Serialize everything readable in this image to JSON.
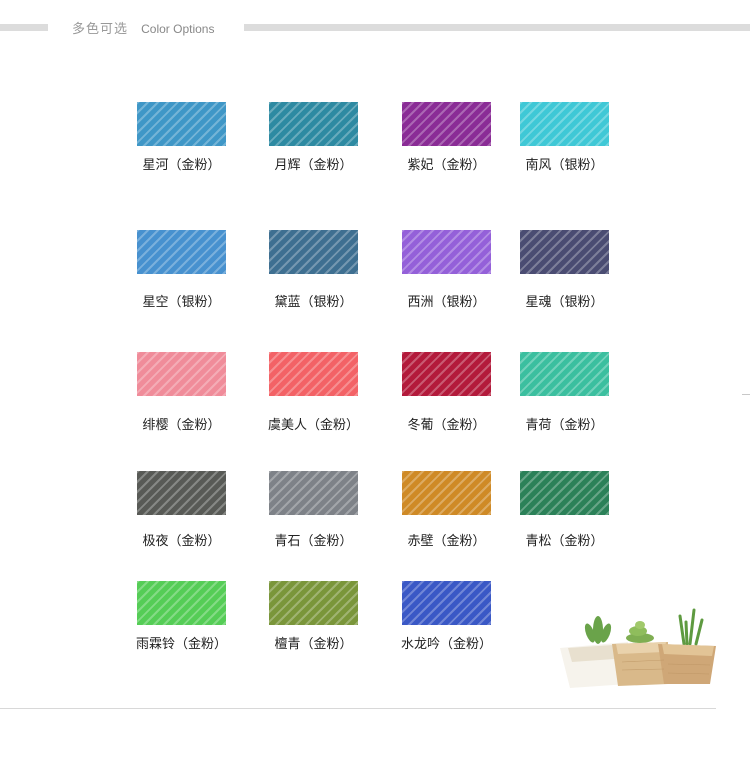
{
  "header": {
    "title_cn": "多色可选",
    "title_en": "Color Options"
  },
  "swatches": [
    {
      "name": "星河（金粉）",
      "color": "#3f97c7"
    },
    {
      "name": "月辉（金粉）",
      "color": "#2d8aa2"
    },
    {
      "name": "紫妃（金粉）",
      "color": "#8a2c96"
    },
    {
      "name": "南风（银粉）",
      "color": "#3fc8d6"
    },
    {
      "name": "星空（银粉）",
      "color": "#4791cf"
    },
    {
      "name": "黛蓝（银粉）",
      "color": "#3e6f91"
    },
    {
      "name": "西洲（银粉）",
      "color": "#9460d9"
    },
    {
      "name": "星魂（银粉）",
      "color": "#4a4c72"
    },
    {
      "name": "绯樱（金粉）",
      "color": "#f08c9a"
    },
    {
      "name": "虞美人（金粉）",
      "color": "#f36266"
    },
    {
      "name": "冬葡（金粉）",
      "color": "#b31a3b"
    },
    {
      "name": "青荷（金粉）",
      "color": "#3bbf9f"
    },
    {
      "name": "极夜（金粉）",
      "color": "#585a56"
    },
    {
      "name": "青石（金粉）",
      "color": "#7e8288"
    },
    {
      "name": "赤壁（金粉）",
      "color": "#cf8a26"
    },
    {
      "name": "青松（金粉）",
      "color": "#2b8158"
    },
    {
      "name": "雨霖铃（金粉）",
      "color": "#55cd56"
    },
    {
      "name": "檀青（金粉）",
      "color": "#7a963a"
    },
    {
      "name": "水龙吟（金粉）",
      "color": "#3a58c6"
    }
  ],
  "decoration": {
    "image": "succulent-planters"
  }
}
